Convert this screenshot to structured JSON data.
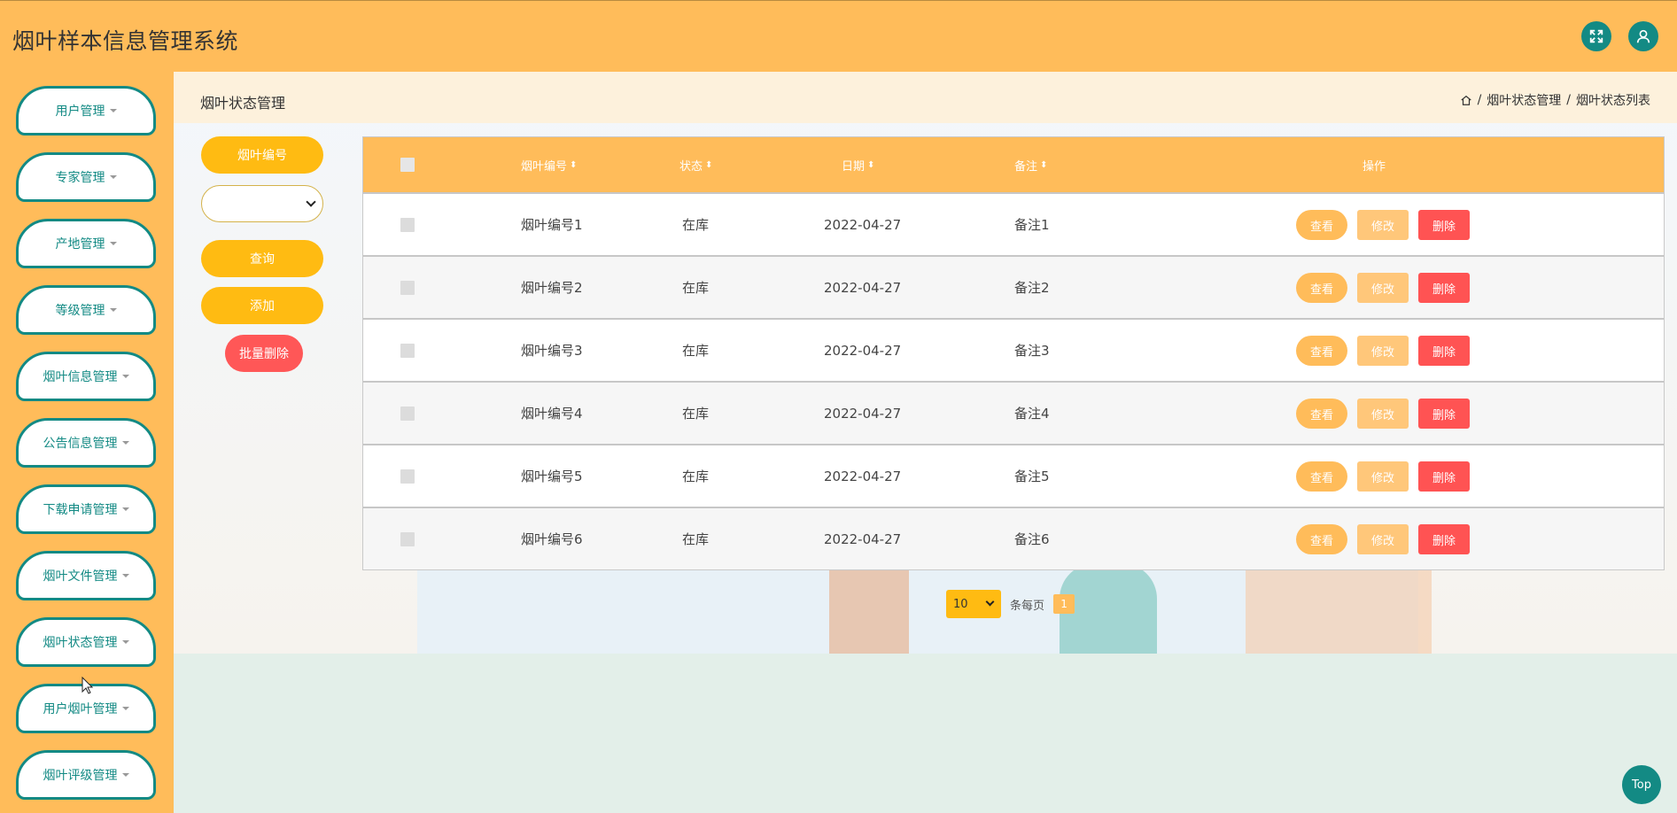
{
  "app": {
    "title": "烟叶样本信息管理系统"
  },
  "topbar": {
    "fullscreen_icon": "expand-icon",
    "user_icon": "user-icon"
  },
  "sidebar": {
    "items": [
      {
        "label": "用户管理"
      },
      {
        "label": "专家管理"
      },
      {
        "label": "产地管理"
      },
      {
        "label": "等级管理"
      },
      {
        "label": "烟叶信息管理"
      },
      {
        "label": "公告信息管理"
      },
      {
        "label": "下载申请管理"
      },
      {
        "label": "烟叶文件管理"
      },
      {
        "label": "烟叶状态管理"
      },
      {
        "label": "用户烟叶管理"
      },
      {
        "label": "烟叶评级管理"
      }
    ]
  },
  "page": {
    "title": "烟叶状态管理",
    "breadcrumb": {
      "sep": "/",
      "item1": "烟叶状态管理",
      "item2": "烟叶状态列表"
    }
  },
  "filter": {
    "field_label": "烟叶编号",
    "select_value": "",
    "search_label": "查询",
    "add_label": "添加",
    "batch_delete_label": "批量删除"
  },
  "table": {
    "headers": {
      "code": "烟叶编号",
      "status": "状态",
      "date": "日期",
      "note": "备注",
      "actions": "操作"
    },
    "actions": {
      "view": "查看",
      "edit": "修改",
      "delete": "删除"
    },
    "rows": [
      {
        "code": "烟叶编号1",
        "status": "在库",
        "date": "2022-04-27",
        "note": "备注1"
      },
      {
        "code": "烟叶编号2",
        "status": "在库",
        "date": "2022-04-27",
        "note": "备注2"
      },
      {
        "code": "烟叶编号3",
        "status": "在库",
        "date": "2022-04-27",
        "note": "备注3"
      },
      {
        "code": "烟叶编号4",
        "status": "在库",
        "date": "2022-04-27",
        "note": "备注4"
      },
      {
        "code": "烟叶编号5",
        "status": "在库",
        "date": "2022-04-27",
        "note": "备注5"
      },
      {
        "code": "烟叶编号6",
        "status": "在库",
        "date": "2022-04-27",
        "note": "备注6"
      }
    ]
  },
  "pager": {
    "page_size": "10",
    "per_page_label": "条每页",
    "current_page": "1"
  },
  "back_to_top": {
    "label": "Top"
  },
  "colors": {
    "primary": "#ffbc5a",
    "accent": "#138a84",
    "danger": "#ff5353",
    "yellow": "#ffbb12"
  }
}
